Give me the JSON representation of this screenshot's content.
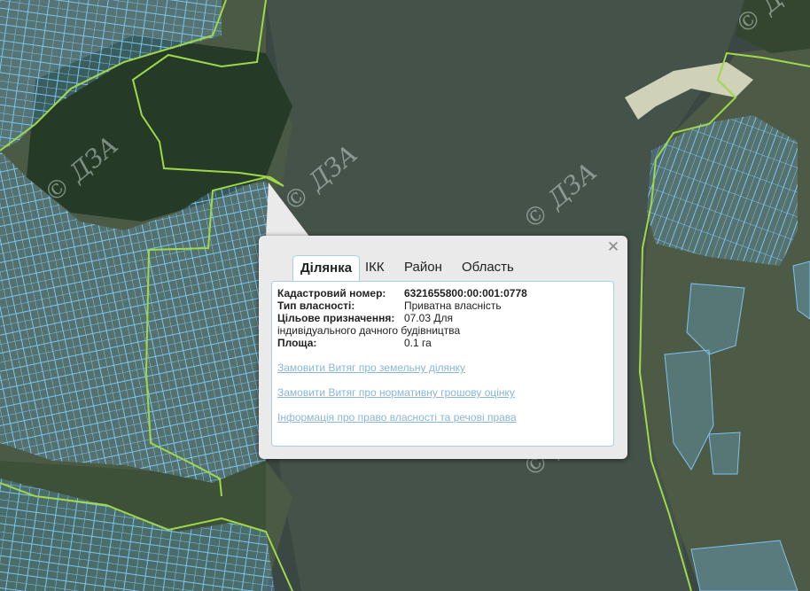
{
  "map": {
    "watermark": "© ДЗА",
    "colors": {
      "parcel_fill": "#6fb6e8",
      "parcel_stroke": "#7ec3f0",
      "boundary": "#9fd84a",
      "water": "#3a4742",
      "forest": "#253a27"
    }
  },
  "popup": {
    "close_icon": "close-icon",
    "tabs": [
      "Ділянка",
      "ІКК",
      "Район",
      "Область"
    ],
    "active_tab": "Ділянка",
    "fields": {
      "cadastral_label": "Кадастровий номер:",
      "cadastral_value": "6321655800:00:001:0778",
      "ownership_label": "Тип власності:",
      "ownership_value": "Приватна власність",
      "purpose_label": "Цільове призначення:",
      "purpose_value": "07.03 Для індивідуального дачного будівництва",
      "area_label": "Площа:",
      "area_value": "0.1 га"
    },
    "links": [
      "Замовити Витяг про земельну ділянку",
      "Замовити Витяг про нормативну грошову оцінку",
      "Інформація про право власності та речові права"
    ]
  }
}
